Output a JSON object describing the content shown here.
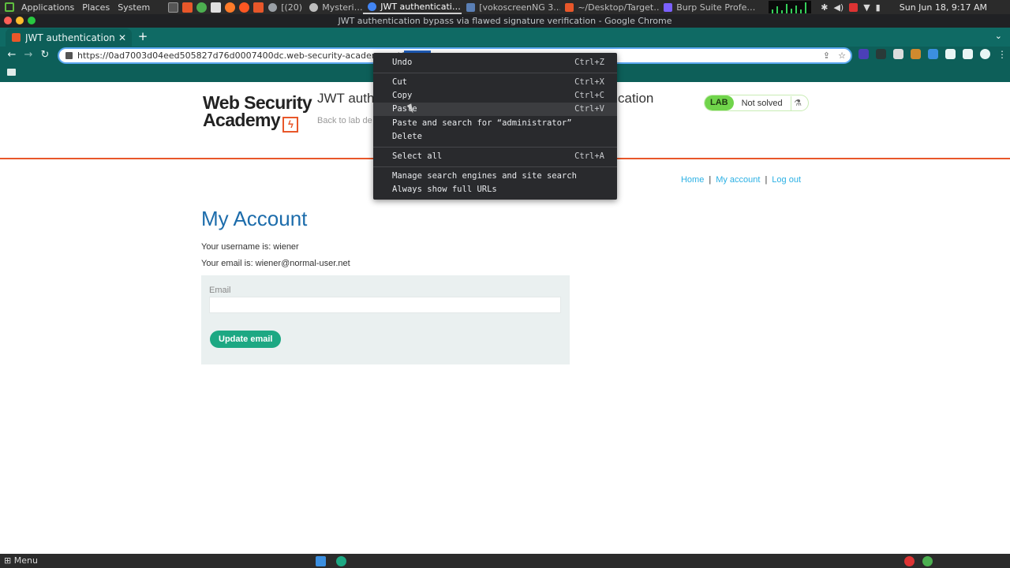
{
  "os_panel": {
    "menus": [
      "Applications",
      "Places",
      "System"
    ],
    "tasks": [
      {
        "label": "[(20)",
        "active": false,
        "color": "#9aa0a6"
      },
      {
        "label": "Mysteri…",
        "active": false,
        "color": "#bdbdbd"
      },
      {
        "label": "JWT authenticati…",
        "active": true,
        "color": "#4285f4"
      },
      {
        "label": "[vokoscreenNG 3.…",
        "active": false,
        "color": "#5a7fb5"
      },
      {
        "label": "~/Desktop/Target…",
        "active": false,
        "color": "#e8572a"
      },
      {
        "label": "Burp Suite Profe…",
        "active": false,
        "color": "#7b61ff"
      }
    ],
    "clock": "Sun Jun 18,  9:17 AM"
  },
  "window": {
    "title": "JWT authentication bypass via flawed signature verification - Google Chrome"
  },
  "tab": {
    "label": "JWT authentication",
    "close": "✕",
    "new_tab": "+",
    "tab_search": "⌄"
  },
  "toolbar": {
    "back": "←",
    "forward": "→",
    "reload": "↻",
    "url_prefix": "https://0ad7003d04eed505827d76d0007400dc.web-security-academy.net/",
    "url_selected": "my-ac",
    "share": "⇪",
    "star": "☆",
    "menu": "⋮"
  },
  "page": {
    "logo_line1": "Web Security",
    "logo_line2": "Academy",
    "logo_mark": "ϟ",
    "lab_title_head": "JWT authe",
    "lab_title_tail": "cation",
    "back_link": "Back to lab de",
    "lab_badge": "LAB",
    "lab_state": "Not solved",
    "lab_flask": "⚗",
    "nav": {
      "home": "Home",
      "account": "My account",
      "logout": "Log out",
      "separator": "|"
    },
    "heading": "My Account",
    "username_line": "Your username is: wiener",
    "email_line": "Your email is: wiener@normal-user.net",
    "email_label": "Email",
    "email_value": "",
    "update_button": "Update email"
  },
  "context_menu": {
    "undo": {
      "label": "Undo",
      "shortcut": "Ctrl+Z"
    },
    "cut": {
      "label": "Cut",
      "shortcut": "Ctrl+X"
    },
    "copy": {
      "label": "Copy",
      "shortcut": "Ctrl+C"
    },
    "paste": {
      "label": "Paste",
      "shortcut": "Ctrl+V"
    },
    "paste_search": {
      "label": "Paste and search for “administrator”"
    },
    "delete": {
      "label": "Delete"
    },
    "select_all": {
      "label": "Select all",
      "shortcut": "Ctrl+A"
    },
    "manage_search": {
      "label": "Manage search engines and site search"
    },
    "full_urls": {
      "label": "Always show full URLs"
    }
  },
  "bottom_panel": {
    "menu": "Menu"
  },
  "colors": {
    "chrome_theme": "#0d5f59",
    "accent_orange": "#e8572a",
    "link_blue": "#2bb0e4",
    "heading_blue": "#1c6cab",
    "button_green": "#1da883",
    "lab_green": "#70d44b"
  }
}
